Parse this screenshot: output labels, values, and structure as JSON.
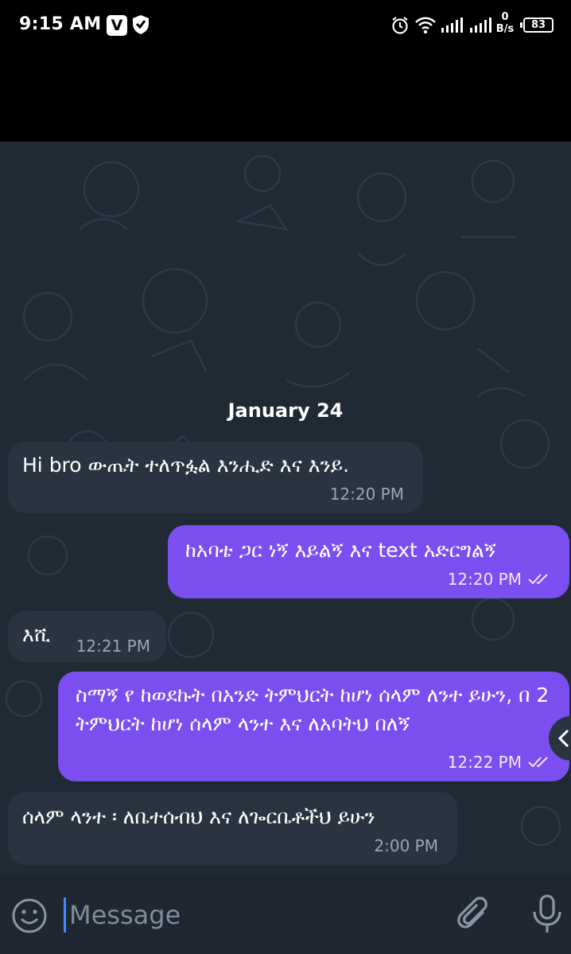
{
  "status_bar": {
    "time": "9:15 AM",
    "vpn_label": "V",
    "network_speed_value": "0",
    "network_speed_unit": "B/s",
    "battery_level": "83"
  },
  "chat": {
    "date_separator": "January 24",
    "messages": [
      {
        "direction": "incoming",
        "text": "Hi bro ውጤት ተለጥፏል እንሒድ እና እንይ.",
        "time": "12:20 PM"
      },
      {
        "direction": "outgoing",
        "text": "ከአባቴ ጋር ነኝ እይልኝ እና text አድርግልኝ",
        "time": "12:20 PM",
        "status": "read"
      },
      {
        "direction": "incoming",
        "text": "እሺ",
        "time": "12:21 PM"
      },
      {
        "direction": "outgoing",
        "text": "ስማኝ የ ከወደኩት በአንድ ትምህርት ከሆነ ሰላም ለንተ ይሁን, በ 2 ትምህርት ከሆነ ሰላም ላንተ እና ለአባትህ በለኝ",
        "time": "12:22 PM",
        "status": "read"
      },
      {
        "direction": "incoming",
        "text": "ሰላም ላንተ ፡ ለቤተሰብህ እና ለጐርቤቶችህ ይሁን",
        "time": "2:00 PM"
      }
    ]
  },
  "composer": {
    "placeholder": "Message"
  },
  "colors": {
    "outgoing_bubble": "#7b4ef0",
    "incoming_bubble": "#2a3440",
    "chat_background": "#1f2a35"
  },
  "icons": [
    "vpn-icon",
    "shield-icon",
    "alarm-icon",
    "wifi-icon",
    "signal-icon",
    "battery-icon",
    "double-check-icon",
    "share-icon",
    "emoji-icon",
    "attach-icon",
    "mic-icon"
  ]
}
